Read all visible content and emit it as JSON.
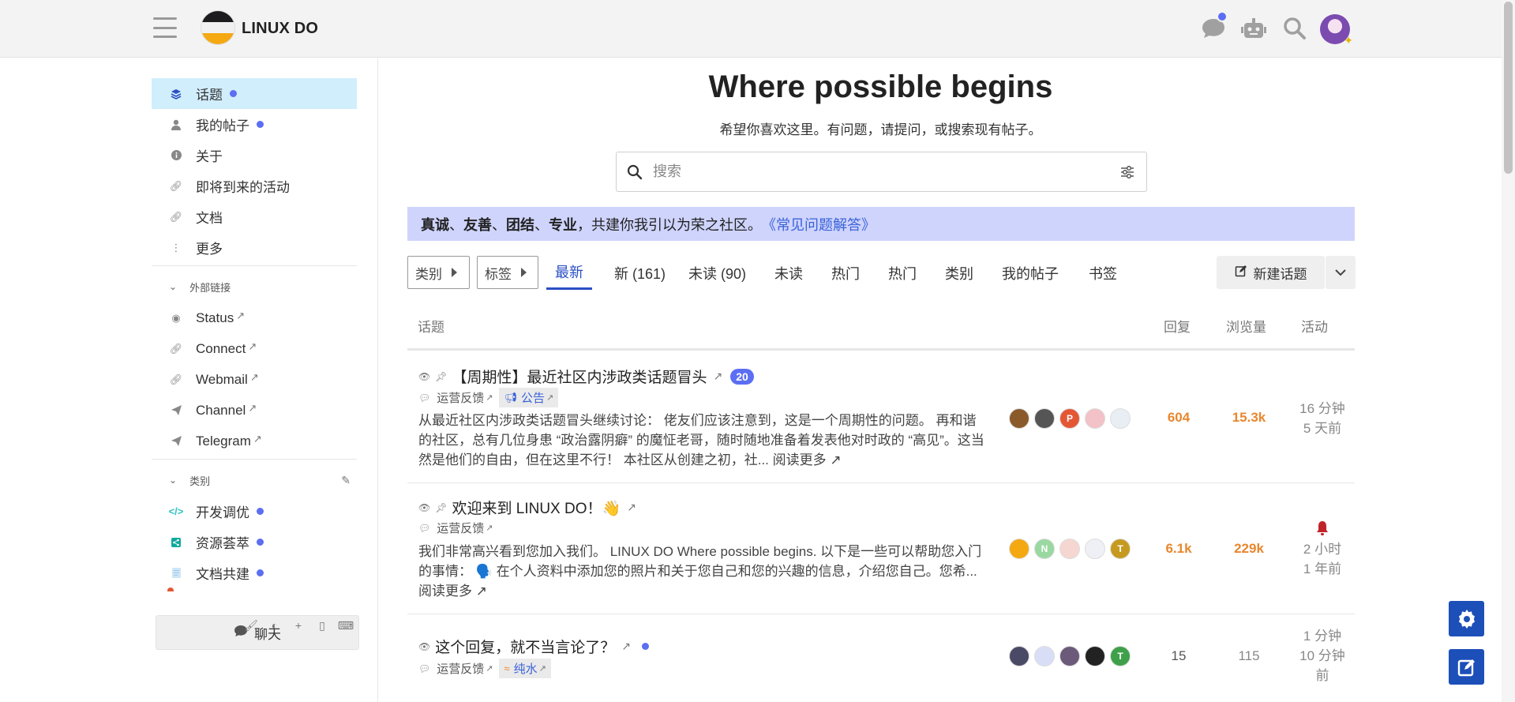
{
  "header": {
    "site_name": "LINUX DO",
    "icons": [
      "menu-icon",
      "chat-icon",
      "robot-icon",
      "search-icon",
      "user-avatar"
    ]
  },
  "sidebar": {
    "items": [
      {
        "label": "话题",
        "icon": "layers-icon",
        "dot": true,
        "active": true
      },
      {
        "label": "我的帖子",
        "icon": "user-icon",
        "dot": true
      },
      {
        "label": "关于",
        "icon": "info-icon"
      },
      {
        "label": "即将到来的活动",
        "icon": "link-icon"
      },
      {
        "label": "文档",
        "icon": "link-icon"
      },
      {
        "label": "更多",
        "icon": "more-vertical-icon"
      }
    ],
    "external_section": "外部链接",
    "external_links": [
      {
        "label": "Status",
        "icon": "eye-icon"
      },
      {
        "label": "Connect",
        "icon": "link-icon"
      },
      {
        "label": "Webmail",
        "icon": "link-icon"
      },
      {
        "label": "Channel",
        "icon": "send-icon"
      },
      {
        "label": "Telegram",
        "icon": "send-icon"
      }
    ],
    "categories_section": "类别",
    "categories": [
      {
        "label": "开发调优",
        "icon": "code-icon",
        "color": "#32c3c3"
      },
      {
        "label": "资源荟萃",
        "icon": "share-icon",
        "color": "#12a89d"
      },
      {
        "label": "文档共建",
        "icon": "document-icon",
        "color": "#99cced"
      }
    ],
    "chat_button": "聊天"
  },
  "main": {
    "hero_title": "Where possible begins",
    "hero_subtitle": "希望你喜欢这里。有问题，请提问，或搜索现有帖子。",
    "search_placeholder": "搜索",
    "banner": {
      "w1": "真诚",
      "s1": "、",
      "w2": "友善",
      "s2": "、",
      "w3": "团结",
      "s3": "、",
      "w4": "专业",
      "rest": "，共建你我引以为荣之社区。",
      "link": "《常见问题解答》"
    },
    "nav": {
      "category_dd": "类别",
      "tag_dd": "标签",
      "tabs": [
        "最新",
        "新 (161)",
        "未读 (90)",
        "未读",
        "热门",
        "热门",
        "类别",
        "我的帖子",
        "书签"
      ],
      "new_topic": "新建话题"
    },
    "table_headers": {
      "topic": "话题",
      "replies": "回复",
      "views": "浏览量",
      "activity": "活动"
    },
    "topics": [
      {
        "title": "【周期性】最近社区内涉政类话题冒头",
        "pinned": true,
        "count_badge": "20",
        "category": "运营反馈",
        "tag": "公告",
        "excerpt": "从最近社区内涉政类话题冒头继续讨论： 佬友们应该注意到，这是一个周期性的问题。 再和谐的社区，总有几位身患 “政治露阴癖” 的魔怔老哥，随时随地准备着发表他对时政的 “高见”。这当然是他们的自由，但在这里不行！ 本社区从创建之初，社...",
        "read_more": "阅读更多",
        "posters": [
          {
            "letter": "",
            "color": "#8a5a2b"
          },
          {
            "letter": "",
            "color": "#555555"
          },
          {
            "letter": "P",
            "color": "#e45735"
          },
          {
            "letter": "",
            "color": "#f3c1c8"
          },
          {
            "letter": "",
            "color": "#e9eef5"
          }
        ],
        "replies": "604",
        "views": "15.3k",
        "activity": [
          "16 分钟",
          "5 天前"
        ]
      },
      {
        "title": "欢迎来到 LINUX DO！👋",
        "pinned": true,
        "category": "运营反馈",
        "excerpt": "我们非常高兴看到您加入我们。 LINUX DO Where possible begins. 以下是一些可以帮助您入门的事情： 🗣️ 在个人资料中添加您的照片和关于您自己和您的兴趣的信息，介绍您自己。您希...",
        "read_more": "阅读更多",
        "posters": [
          {
            "letter": "",
            "color": "#f4a811"
          },
          {
            "letter": "N",
            "color": "#9ad8a2"
          },
          {
            "letter": "",
            "color": "#f6d6d0"
          },
          {
            "letter": "",
            "color": "#eef0f5"
          },
          {
            "letter": "T",
            "color": "#c69a1f"
          }
        ],
        "replies": "6.1k",
        "views": "229k",
        "activity": [
          "2 小时",
          "1 年前"
        ]
      },
      {
        "title": "这个回复，就不当言论了？",
        "unread_dot": true,
        "category": "运营反馈",
        "tag": "纯水",
        "posters": [
          {
            "letter": "",
            "color": "#4a4a66"
          },
          {
            "letter": "",
            "color": "#d9def7"
          },
          {
            "letter": "",
            "color": "#6b5a7a"
          },
          {
            "letter": "",
            "color": "#222222"
          },
          {
            "letter": "T",
            "color": "#3fa04a"
          }
        ],
        "replies": "15",
        "views": "115",
        "activity": [
          "1 分钟",
          "10 分钟",
          "前"
        ]
      }
    ]
  },
  "colors": {
    "accent": "#5c6ef2",
    "active_sidebar": "#d1eefc",
    "banner_bg": "#cfd4fc",
    "link": "#3a62d9",
    "stat_orange": "#e9872e",
    "fab": "#1d4fb8"
  }
}
